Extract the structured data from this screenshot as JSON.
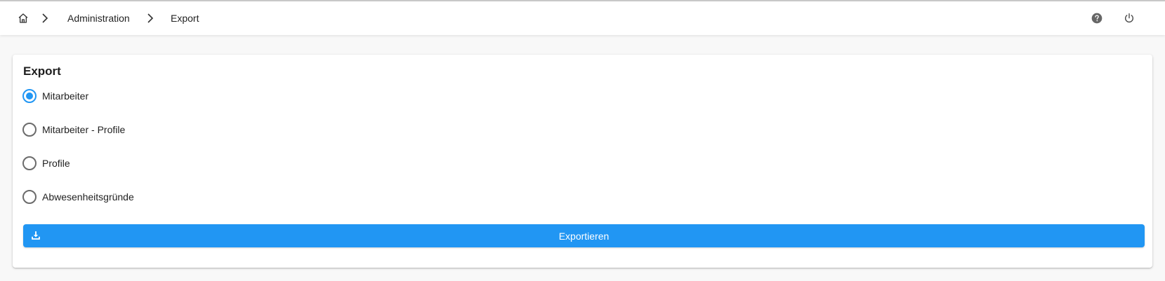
{
  "breadcrumb": {
    "home_icon": "home-icon",
    "items": [
      {
        "label": "Administration"
      },
      {
        "label": "Export"
      }
    ]
  },
  "topbar_actions": {
    "help_icon": "help-circle-icon",
    "power_icon": "power-icon"
  },
  "export_card": {
    "title": "Export",
    "options": [
      {
        "label": "Mitarbeiter",
        "checked": true
      },
      {
        "label": "Mitarbeiter - Profile",
        "checked": false
      },
      {
        "label": "Profile",
        "checked": false
      },
      {
        "label": "Abwesenheitsgründe",
        "checked": false
      }
    ],
    "button": {
      "label": "Exportieren",
      "icon": "download-icon"
    }
  },
  "colors": {
    "accent": "#2196f3",
    "page_background": "#f8f8f8",
    "card_background": "#ffffff"
  }
}
